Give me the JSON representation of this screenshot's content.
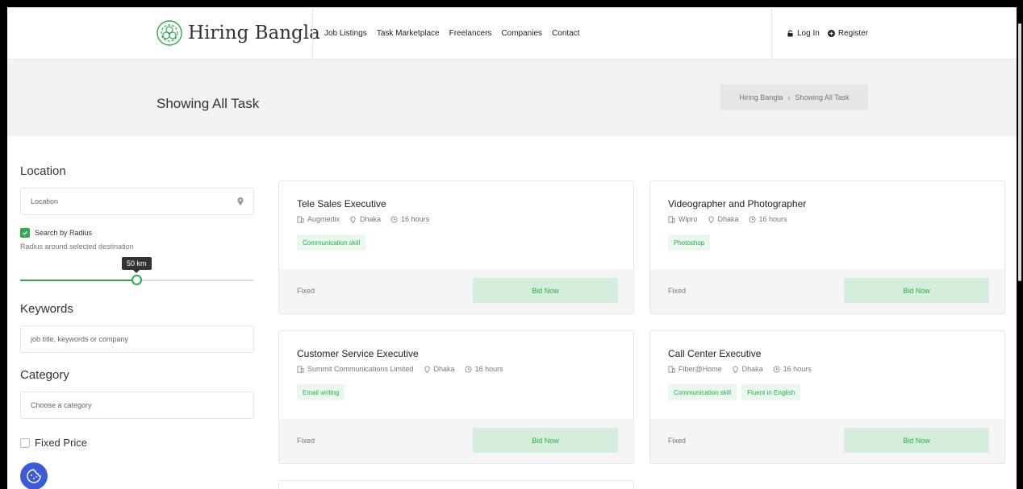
{
  "header": {
    "logo_text": "Hiring Bangla",
    "nav": [
      "Job Listings",
      "Task Marketplace",
      "Freelancers",
      "Companies",
      "Contact"
    ],
    "login_label": "Log In",
    "register_label": "Register"
  },
  "title_band": {
    "title": "Showing All Task",
    "breadcrumb": [
      "Hiring Bangla",
      "Showing All Task"
    ],
    "breadcrumb_separator": "›"
  },
  "sidebar": {
    "location_heading": "Location",
    "location_placeholder": "Location",
    "radius_checkbox_label": "Search by Radius",
    "radius_checked": true,
    "radius_hint": "Radius around selected destination",
    "radius_value_label": "50 km",
    "radius_fraction": 0.5,
    "keywords_heading": "Keywords",
    "keywords_placeholder": "job title, keywords or company",
    "category_heading": "Category",
    "category_placeholder": "Choose a category",
    "fixed_price_label": "Fixed Price"
  },
  "tasks": [
    {
      "title": "Tele Sales Executive",
      "company": "Augmedix",
      "location": "Dhaka",
      "time": "16 hours",
      "tags": [
        "Communication skill"
      ],
      "price_type": "Fixed",
      "bid_label": "Bid Now"
    },
    {
      "title": "Videographer and Photographer",
      "company": "Wipro",
      "location": "Dhaka",
      "time": "16 hours",
      "tags": [
        "Photoshop"
      ],
      "price_type": "Fixed",
      "bid_label": "Bid Now"
    },
    {
      "title": "Customer Service Executive",
      "company": "Summit Communications Limited",
      "location": "Dhaka",
      "time": "16 hours",
      "tags": [
        "Email writing"
      ],
      "price_type": "Fixed",
      "bid_label": "Bid Now"
    },
    {
      "title": "Call Center Executive",
      "company": "Fiber@Home",
      "location": "Dhaka",
      "time": "16 hours",
      "tags": [
        "Communication skill",
        "Fluent in English"
      ],
      "price_type": "Fixed",
      "bid_label": "Bid Now"
    }
  ],
  "colors": {
    "accent": "#2eaa4f",
    "tag_bg": "#e9f7ee",
    "bid_bg": "#d4eddc",
    "cookie": "#3d5bd9"
  },
  "icons": [
    "logo-mark-icon",
    "map-pin-icon",
    "lock-icon",
    "plus-circle-icon",
    "building-icon",
    "location-icon",
    "clock-icon",
    "check-icon",
    "cookie-icon"
  ]
}
